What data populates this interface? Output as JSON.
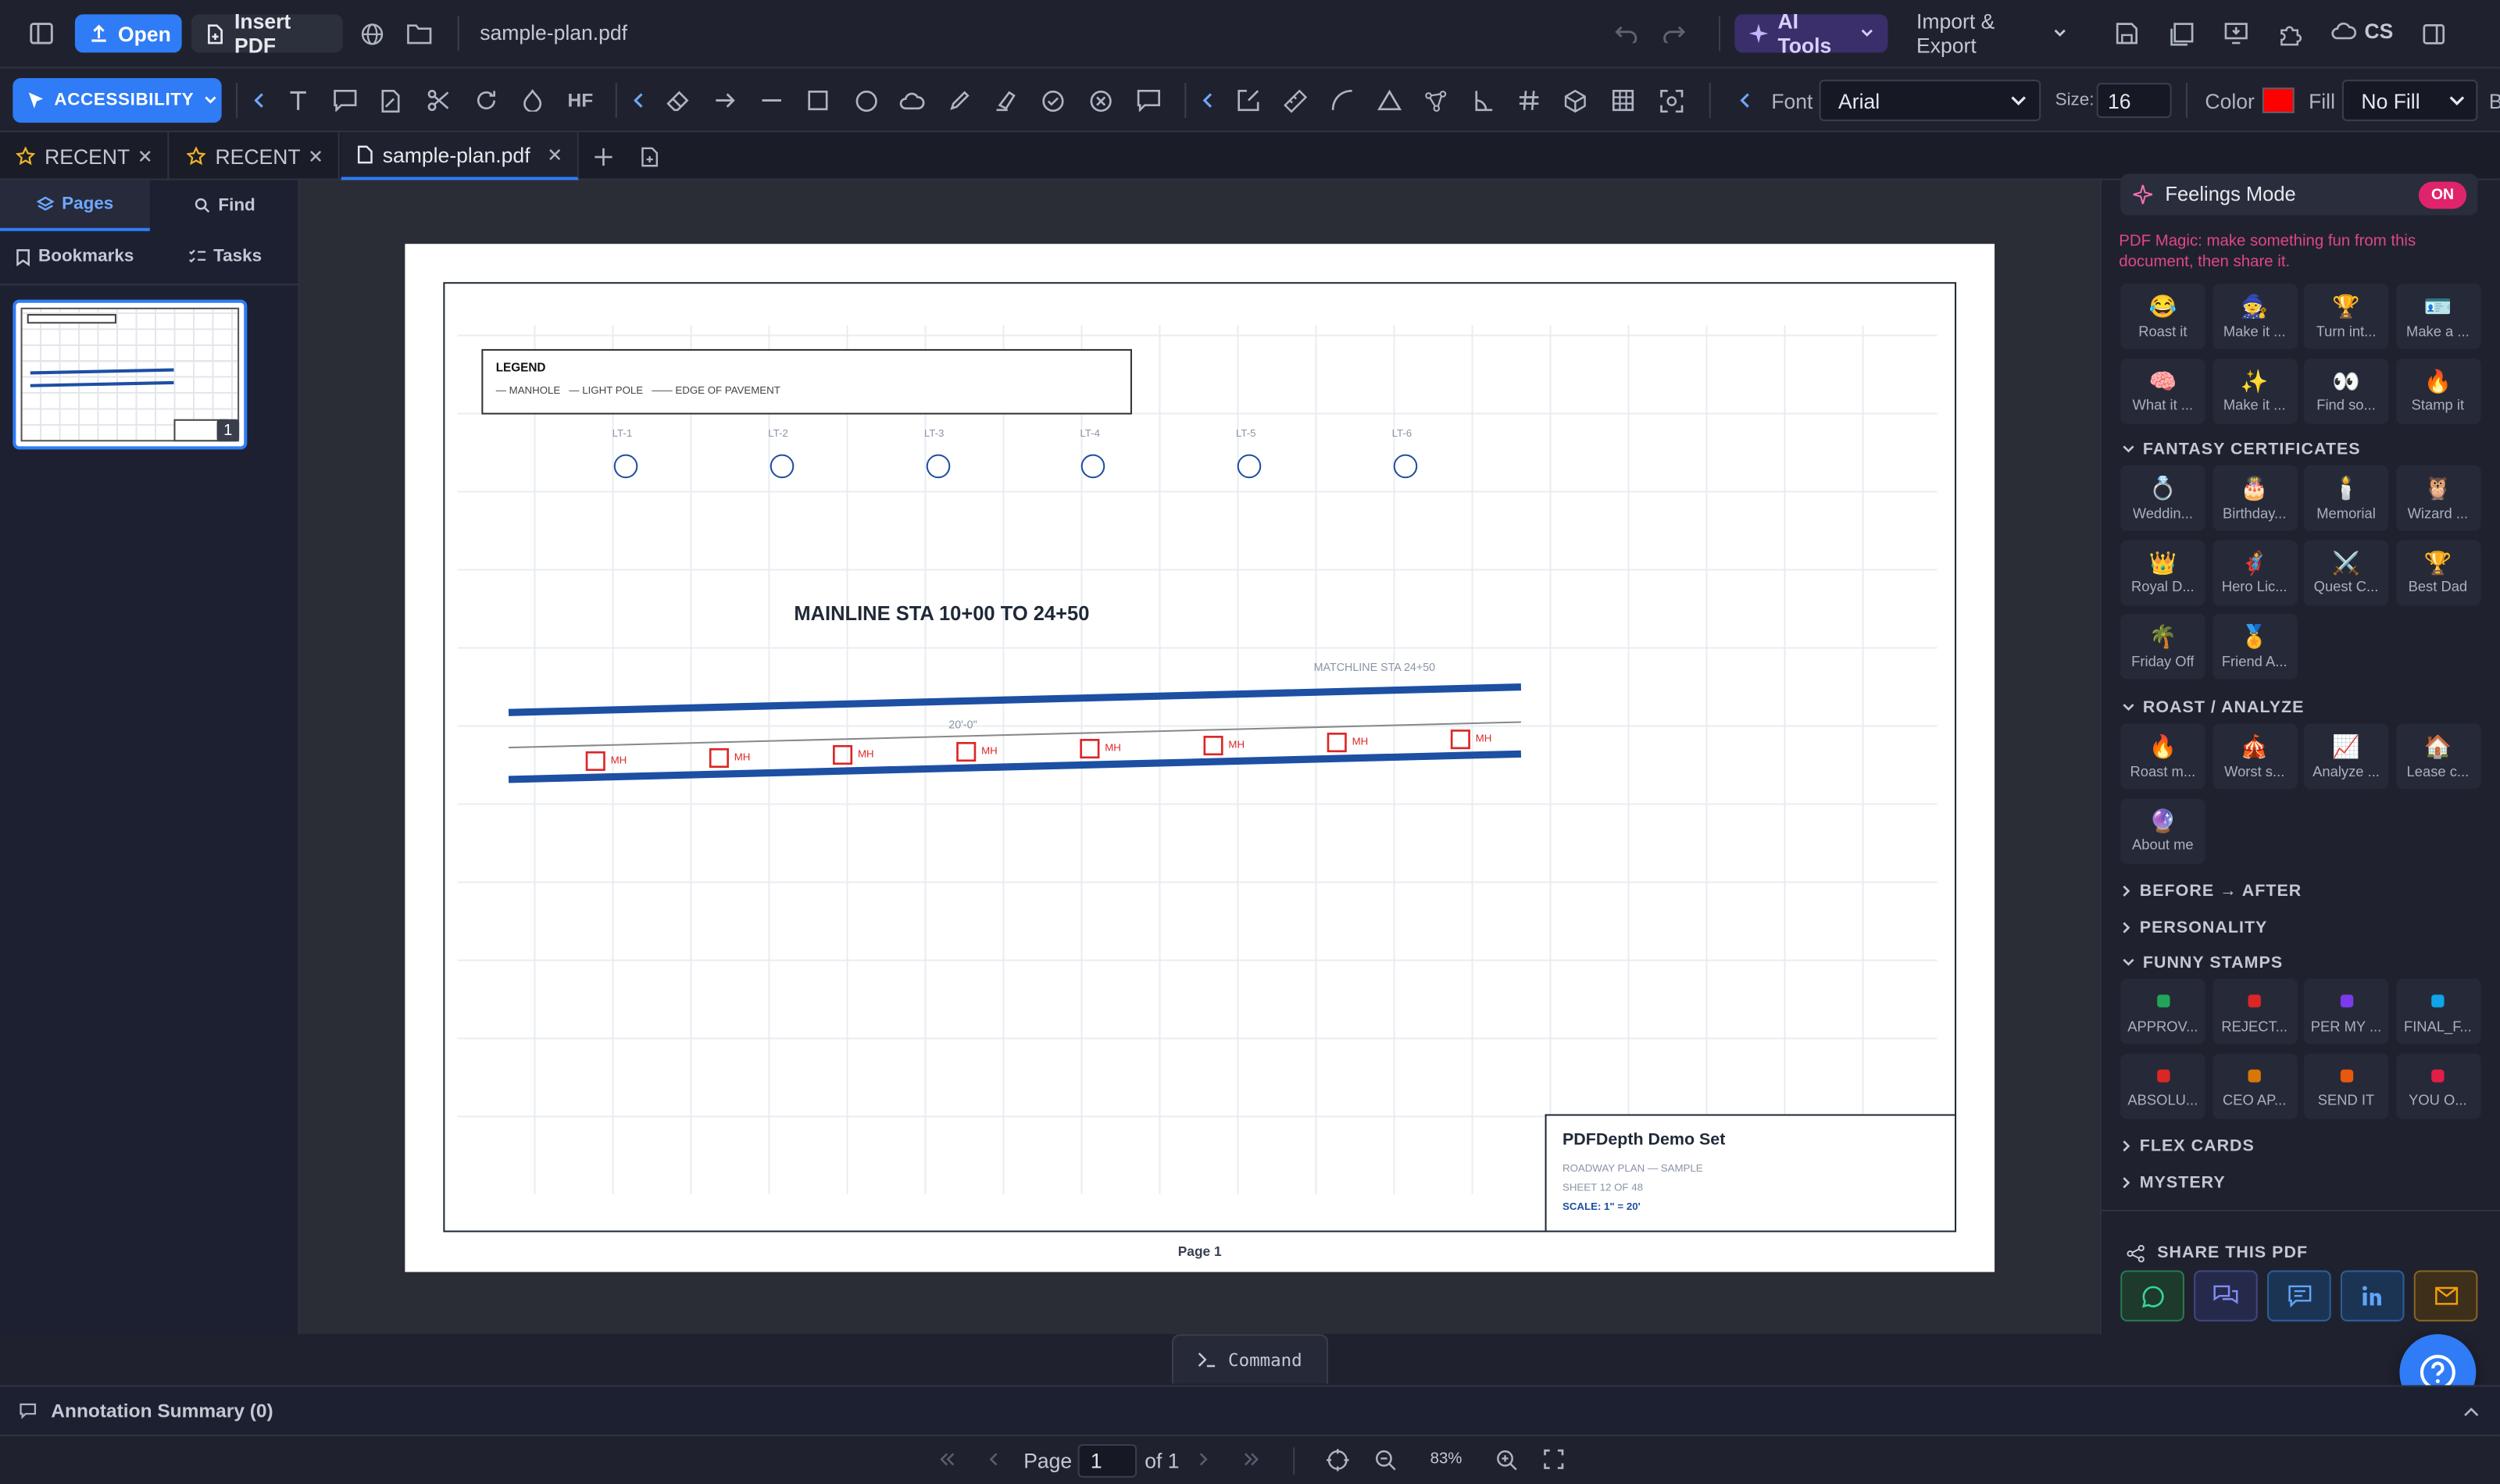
{
  "topbar": {
    "open_label": "Open",
    "insert_pdf_label": "Insert PDF",
    "filename": "sample-plan.pdf",
    "ai_tools_label": "AI Tools",
    "import_export_label": "Import & Export",
    "user_initials": "CS"
  },
  "toolbar": {
    "accessibility_label": "ACCESSIBILITY",
    "hf_label": "HF",
    "font_label": "Font",
    "font_value": "Arial",
    "size_label": "Size:",
    "size_value": "16",
    "color_label": "Color",
    "color_value": "#ff0000",
    "fill_label": "Fill",
    "fill_value": "No Fill",
    "cutoff_label": "B"
  },
  "tabs": [
    {
      "label": "RECENT"
    },
    {
      "label": "RECENT"
    },
    {
      "label": "sample-plan.pdf"
    }
  ],
  "leftpanel": {
    "pages_label": "Pages",
    "find_label": "Find",
    "bookmarks_label": "Bookmarks",
    "tasks_label": "Tasks",
    "thumb_page_number": "1"
  },
  "document": {
    "legend_title": "LEGEND",
    "legend_items": "— MANHOLE   — LIGHT POLE   —— EDGE OF PAVEMENT",
    "poles": [
      "LT-1",
      "LT-2",
      "LT-3",
      "LT-4",
      "LT-5",
      "LT-6"
    ],
    "main_title": "MAINLINE STA 10+00 TO 24+50",
    "matchline": "MATCHLINE STA 24+50",
    "dimension": "20'-0\"",
    "manhole_label": "MH",
    "titleblock_title": "PDFDepth Demo Set",
    "titleblock_sub": "ROADWAY PLAN — SAMPLE",
    "titleblock_sheet": "SHEET 12 OF 48",
    "titleblock_scale": "SCALE: 1\" = 20'",
    "page_caption": "Page 1"
  },
  "rightpanel": {
    "feelings_label": "Feelings Mode",
    "feelings_state": "ON",
    "magic_text": "PDF Magic: make something fun from this document, then share it.",
    "magic_tiles": [
      {
        "icon": "😂",
        "label": "Roast it"
      },
      {
        "icon": "🧙",
        "label": "Make it ..."
      },
      {
        "icon": "🏆",
        "label": "Turn int..."
      },
      {
        "icon": "🪪",
        "label": "Make a ..."
      },
      {
        "icon": "🧠",
        "label": "What it ..."
      },
      {
        "icon": "✨",
        "label": "Make it ..."
      },
      {
        "icon": "👀",
        "label": "Find so..."
      },
      {
        "icon": "🔥",
        "label": "Stamp it"
      }
    ],
    "fantasy_title": "FANTASY CERTIFICATES",
    "fantasy_tiles": [
      {
        "icon": "💍",
        "label": "Weddin..."
      },
      {
        "icon": "🎂",
        "label": "Birthday..."
      },
      {
        "icon": "🕯️",
        "label": "Memorial"
      },
      {
        "icon": "🦉",
        "label": "Wizard ..."
      },
      {
        "icon": "👑",
        "label": "Royal D..."
      },
      {
        "icon": "🦸",
        "label": "Hero Lic..."
      },
      {
        "icon": "⚔️",
        "label": "Quest C..."
      },
      {
        "icon": "🏆",
        "label": "Best Dad"
      },
      {
        "icon": "🌴",
        "label": "Friday Off"
      },
      {
        "icon": "🏅",
        "label": "Friend A..."
      }
    ],
    "roast_title": "ROAST / ANALYZE",
    "roast_tiles": [
      {
        "icon": "🔥",
        "label": "Roast m..."
      },
      {
        "icon": "🎪",
        "label": "Worst s..."
      },
      {
        "icon": "📈",
        "label": "Analyze ..."
      },
      {
        "icon": "🏠",
        "label": "Lease c..."
      },
      {
        "icon": "🔮",
        "label": "About me"
      }
    ],
    "before_after_title": "BEFORE → AFTER",
    "personality_title": "PERSONALITY",
    "stamps_title": "FUNNY STAMPS",
    "stamp_tiles": [
      {
        "color": "#22a559",
        "label": "APPROV..."
      },
      {
        "color": "#dc2626",
        "label": "REJECT..."
      },
      {
        "color": "#7c3aed",
        "label": "PER MY ..."
      },
      {
        "color": "#0ea5e9",
        "label": "FINAL_F..."
      },
      {
        "color": "#dc2626",
        "label": "ABSOLU..."
      },
      {
        "color": "#d97706",
        "label": "CEO AP..."
      },
      {
        "color": "#ea580c",
        "label": "SEND IT"
      },
      {
        "color": "#e11d48",
        "label": "YOU O..."
      }
    ],
    "flex_title": "FLEX CARDS",
    "mystery_title": "MYSTERY",
    "share_title": "SHARE THIS PDF"
  },
  "command_label": "Command",
  "annotation_summary": "Annotation Summary (0)",
  "pagination": {
    "page_label": "Page",
    "page_value": "1",
    "of_label": "of 1",
    "zoom": "83%"
  },
  "colors": {
    "accent": "#2f7cf6",
    "danger": "#ff0000",
    "pink_toggle": "#e0246b",
    "ai_purple": "#3a2f6b"
  }
}
